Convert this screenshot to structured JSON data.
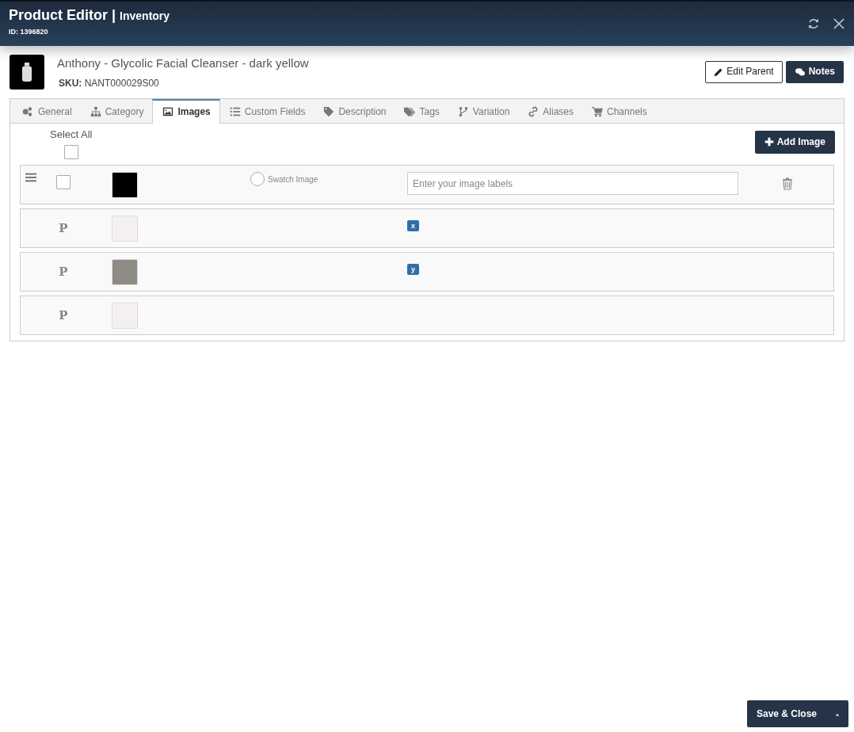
{
  "window": {
    "title": "Product Editor",
    "separator": "|",
    "subtitle": "Inventory",
    "id_text": "ID: 1396820"
  },
  "product": {
    "name": "Anthony - Glycolic Facial Cleanser - dark yellow",
    "sku_label": "SKU:",
    "sku": "NANT000029S00"
  },
  "header_buttons": [
    {
      "label": "Edit Parent",
      "kind": "outline"
    },
    {
      "label": "Notes",
      "kind": "dark"
    }
  ],
  "tabs": [
    {
      "label": "General",
      "selected": false
    },
    {
      "label": "Category",
      "selected": false
    },
    {
      "label": "Images",
      "selected": true
    },
    {
      "label": "Custom Fields",
      "selected": false
    },
    {
      "label": "Description",
      "selected": false
    },
    {
      "label": "Tags",
      "selected": false
    },
    {
      "label": "Variation",
      "selected": false
    },
    {
      "label": "Aliases",
      "selected": false
    },
    {
      "label": "Channels",
      "selected": false
    }
  ],
  "select_all": {
    "label": "Select All",
    "checked": false
  },
  "add_image_button": "Add Image",
  "images": [
    {
      "kind": "own",
      "checked": false,
      "swatch": {
        "label": "Swatch Image",
        "selected": false
      },
      "labels_placeholder": "Enter your image labels"
    },
    {
      "kind": "parent",
      "marker": "P",
      "label_badge": "x"
    },
    {
      "kind": "parent",
      "marker": "P",
      "label_badge": "y"
    },
    {
      "kind": "parent",
      "marker": "P"
    }
  ],
  "footer": {
    "save_button": "Save & Close"
  }
}
